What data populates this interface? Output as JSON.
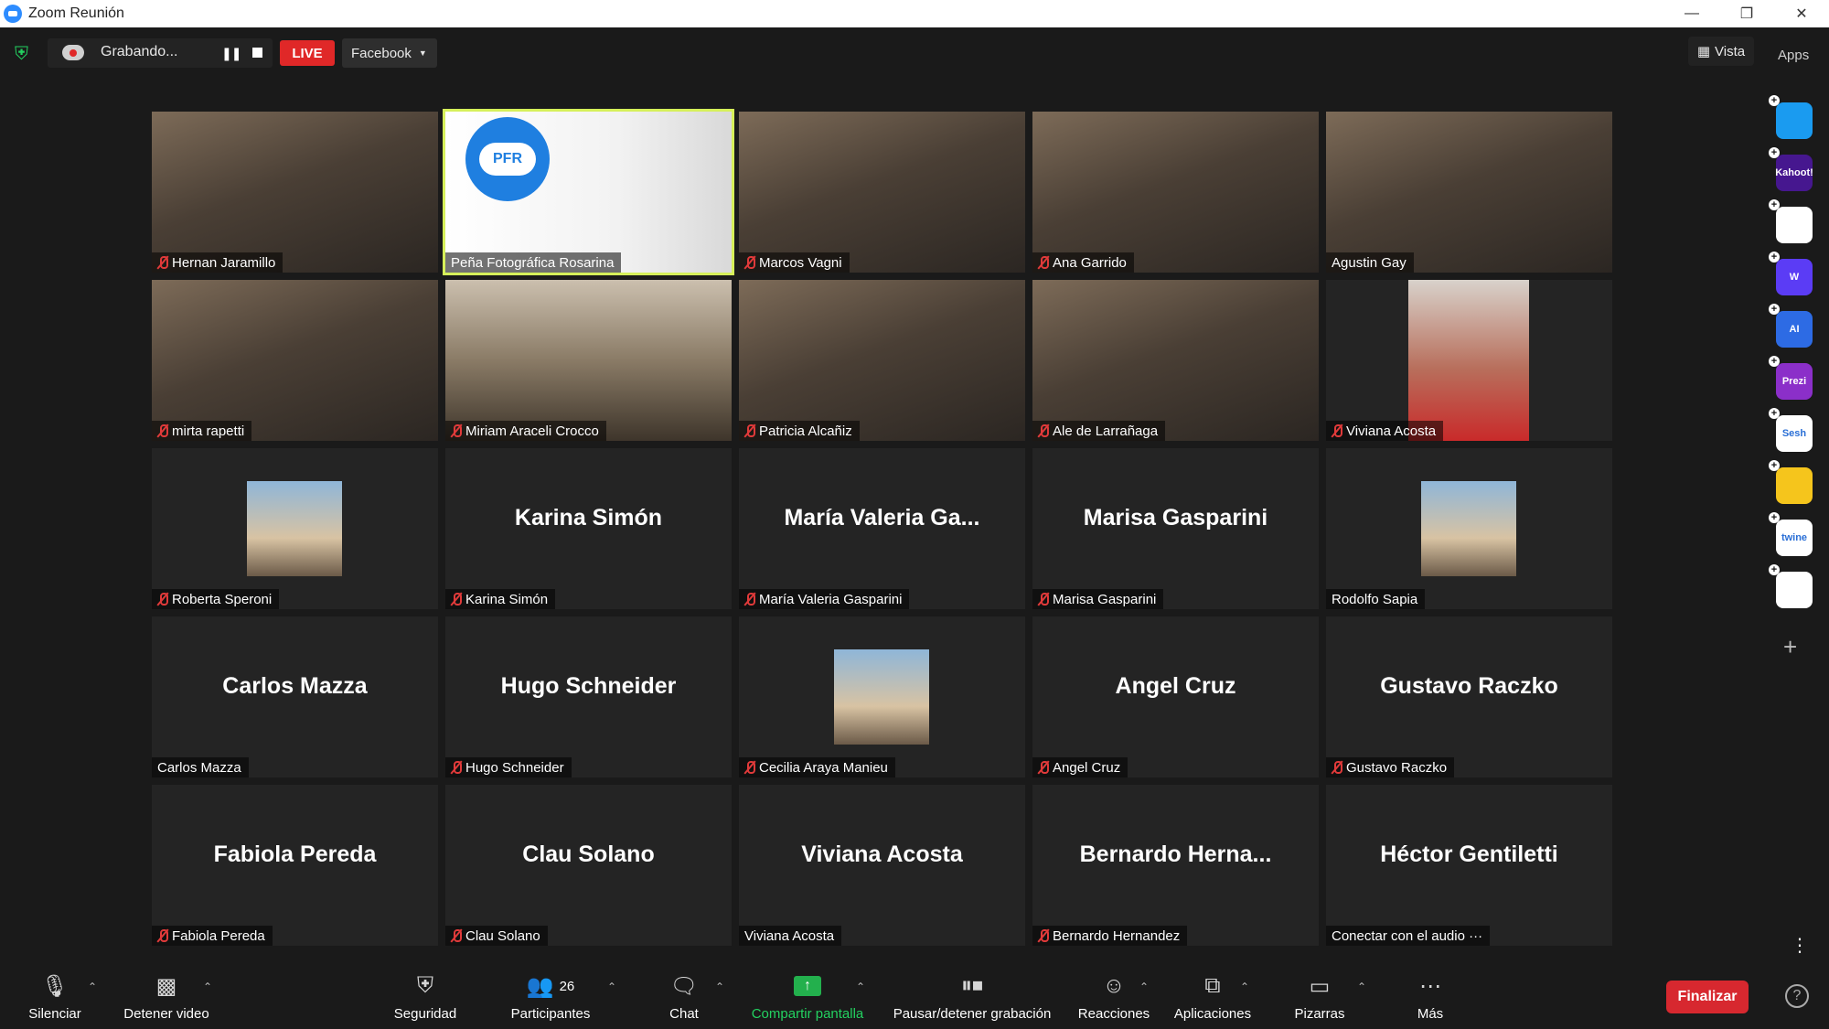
{
  "window": {
    "title": "Zoom Reunión"
  },
  "topbar": {
    "recording_label": "Grabando...",
    "live_label": "LIVE",
    "platform": "Facebook",
    "view_label": "Vista",
    "apps_label": "Apps"
  },
  "participants": [
    {
      "name": "Hernan Jaramillo",
      "muted": true,
      "video": "room"
    },
    {
      "name": "Peña Fotográfica Rosarina",
      "muted": false,
      "video": "logo",
      "logo_text": "PFR",
      "active": true
    },
    {
      "name": "Marcos Vagni",
      "muted": true,
      "video": "room"
    },
    {
      "name": "Ana Garrido",
      "muted": true,
      "video": "room"
    },
    {
      "name": "Agustin Gay",
      "muted": false,
      "video": "room"
    },
    {
      "name": "mirta rapetti",
      "muted": true,
      "video": "room"
    },
    {
      "name": "Miriam Araceli Crocco",
      "muted": true,
      "video": "sepia"
    },
    {
      "name": "Patricia Alcañiz",
      "muted": true,
      "video": "room"
    },
    {
      "name": "Ale de Larrañaga",
      "muted": true,
      "video": "room"
    },
    {
      "name": "Viviana Acosta",
      "muted": true,
      "video": "portrait"
    },
    {
      "name": "Roberta Speroni",
      "muted": true,
      "video": "avatar"
    },
    {
      "name": "Karina Simón",
      "display": "Karina Simón",
      "muted": true,
      "video": "none"
    },
    {
      "name": "María Valeria Gasparini",
      "display": "María  Valeria  Ga...",
      "muted": true,
      "video": "none"
    },
    {
      "name": "Marisa Gasparini",
      "display": "Marisa Gasparini",
      "muted": true,
      "video": "none"
    },
    {
      "name": "Rodolfo Sapia",
      "muted": false,
      "video": "avatar"
    },
    {
      "name": "Carlos Mazza",
      "display": "Carlos Mazza",
      "muted": false,
      "video": "none"
    },
    {
      "name": "Hugo Schneider",
      "display": "Hugo Schneider",
      "muted": true,
      "video": "none"
    },
    {
      "name": "Cecilia Araya Manieu",
      "muted": true,
      "video": "avatar"
    },
    {
      "name": "Angel Cruz",
      "display": "Angel Cruz",
      "muted": true,
      "video": "none"
    },
    {
      "name": "Gustavo Raczko",
      "display": "Gustavo Raczko",
      "muted": true,
      "video": "none"
    },
    {
      "name": "Fabiola Pereda",
      "display": "Fabiola Pereda",
      "muted": true,
      "video": "none"
    },
    {
      "name": "Clau Solano",
      "display": "Clau Solano",
      "muted": true,
      "video": "none"
    },
    {
      "name": "Viviana Acosta",
      "display": "Viviana Acosta",
      "muted": false,
      "video": "none"
    },
    {
      "name": "Bernardo Hernandez",
      "display": "Bernardo  Herna...",
      "muted": true,
      "video": "none"
    },
    {
      "name": "Conectar con el audio ···",
      "display": "Héctor Gentiletti",
      "muted": false,
      "video": "none"
    }
  ],
  "sidebar_apps": [
    {
      "name": "app-arrow",
      "label": "",
      "color": "#1a9bf0"
    },
    {
      "name": "app-kahoot",
      "label": "Kahoot!",
      "color": "#46178f"
    },
    {
      "name": "app-red",
      "label": "",
      "color": "#ffffff"
    },
    {
      "name": "app-wooclap",
      "label": "W",
      "color": "#5b3cf5"
    },
    {
      "name": "app-ai",
      "label": "AI",
      "color": "#2d6be4"
    },
    {
      "name": "app-prezi",
      "label": "Prezi",
      "color": "#8b2fc9"
    },
    {
      "name": "app-sesh",
      "label": "Sesh",
      "color": "#ffffff"
    },
    {
      "name": "app-emoji",
      "label": "",
      "color": "#f5c51c"
    },
    {
      "name": "app-twine",
      "label": "twine",
      "color": "#ffffff"
    },
    {
      "name": "app-grid",
      "label": "",
      "color": "#ffffff"
    }
  ],
  "toolbar": {
    "mute": "Silenciar",
    "video": "Detener video",
    "security": "Seguridad",
    "participants": "Participantes",
    "participants_count": "26",
    "chat": "Chat",
    "share": "Compartir pantalla",
    "pause_record": "Pausar/detener grabación",
    "reactions": "Reacciones",
    "apps": "Aplicaciones",
    "whiteboards": "Pizarras",
    "more": "Más",
    "end": "Finalizar"
  },
  "colors": {
    "accent_green": "#23d160",
    "end_red": "#d7282f",
    "active_border": "#d6f05a",
    "live_red": "#e02828"
  }
}
